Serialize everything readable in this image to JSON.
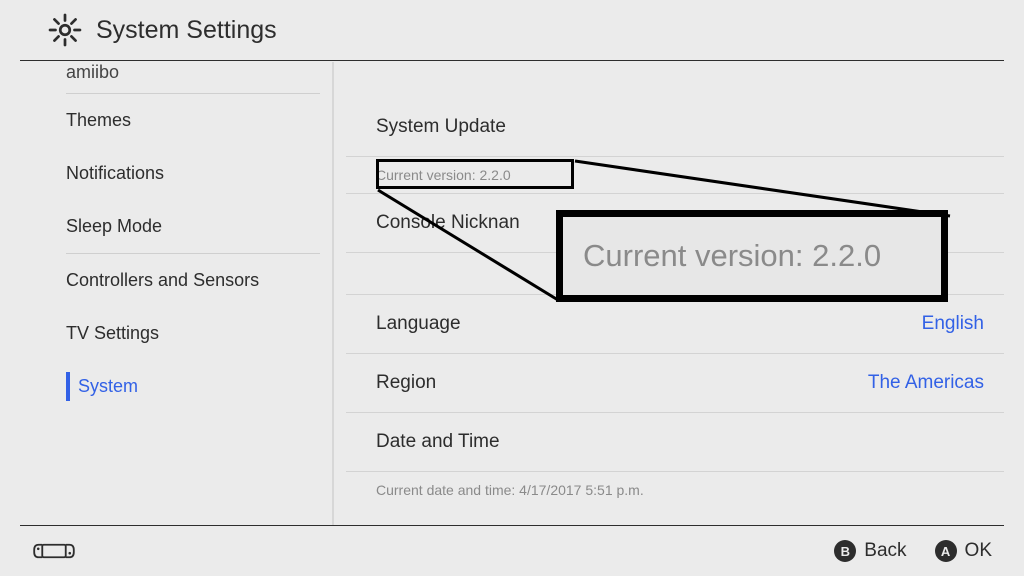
{
  "header": {
    "title": "System Settings"
  },
  "sidebar": {
    "truncated": "amiibo",
    "groupA": [
      "Themes",
      "Notifications",
      "Sleep Mode"
    ],
    "groupB": [
      "Controllers and Sensors",
      "TV Settings",
      "System"
    ],
    "selected": "System"
  },
  "content": {
    "system_update": {
      "label": "System Update",
      "current_version": "Current version: 2.2.0"
    },
    "console_nickname": {
      "label": "Console Nicknan"
    },
    "language": {
      "label": "Language",
      "value": "English"
    },
    "region": {
      "label": "Region",
      "value": "The Americas"
    },
    "date_time": {
      "label": "Date and Time",
      "current": "Current date and time: 4/17/2017 5:51 p.m."
    }
  },
  "callout": {
    "text": "Current version: 2.2.0"
  },
  "footer": {
    "back": {
      "glyph": "B",
      "label": "Back"
    },
    "ok": {
      "glyph": "A",
      "label": "OK"
    }
  }
}
